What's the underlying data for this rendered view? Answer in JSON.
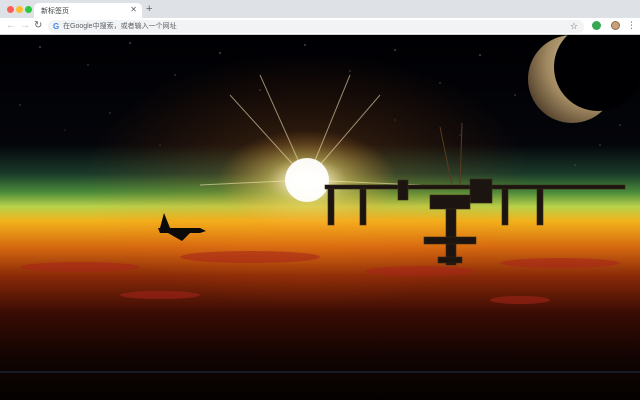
{
  "window": {
    "tab_title": "新标签页",
    "tab_close_icon": "close-icon",
    "new_tab_icon": "plus-icon"
  },
  "toolbar": {
    "back_icon": "arrow-left-icon",
    "forward_icon": "arrow-right-icon",
    "reload_icon": "reload-icon",
    "search_engine_icon": "google-icon",
    "omnibox_placeholder": "在Google中搜索，或者输入一个网址",
    "bookmark_icon": "star-icon",
    "extension_icon": "extension-icon",
    "profile_icon": "avatar-icon",
    "menu_icon": "more-vert-icon"
  },
  "wallpaper": {
    "subject": "space station and shuttle over sunrise"
  },
  "colors": {
    "chrome_bg": "#dee1e6",
    "toolbar_bg": "#ffffff",
    "omnibox_bg": "#f1f3f4"
  }
}
